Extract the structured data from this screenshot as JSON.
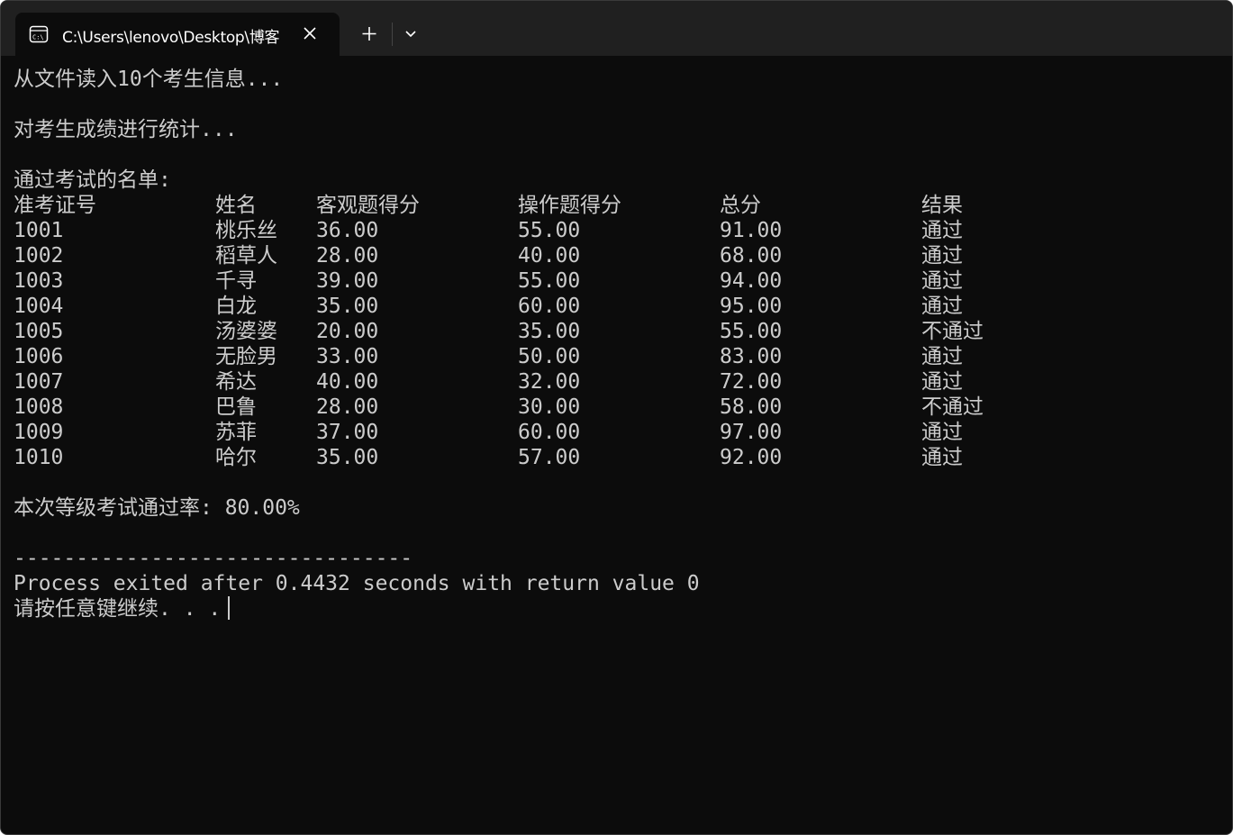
{
  "window": {
    "tab_title": "C:\\Users\\lenovo\\Desktop\\博客",
    "icons": {
      "tab": "terminal-icon",
      "close": "close-icon",
      "new_tab": "plus-icon",
      "dropdown": "chevron-down-icon"
    }
  },
  "console": {
    "line_read": "从文件读入10个考生信息...",
    "line_stats": "对考生成绩进行统计...",
    "line_pass_list": "通过考试的名单:",
    "table": {
      "headers": [
        "准考证号",
        "姓名",
        "客观题得分",
        "操作题得分",
        "总分",
        "结果"
      ],
      "rows": [
        [
          "1001",
          "桃乐丝",
          "36.00",
          "55.00",
          "91.00",
          "通过"
        ],
        [
          "1002",
          "稻草人",
          "28.00",
          "40.00",
          "68.00",
          "通过"
        ],
        [
          "1003",
          "千寻",
          "39.00",
          "55.00",
          "94.00",
          "通过"
        ],
        [
          "1004",
          "白龙",
          "35.00",
          "60.00",
          "95.00",
          "通过"
        ],
        [
          "1005",
          "汤婆婆",
          "20.00",
          "35.00",
          "55.00",
          "不通过"
        ],
        [
          "1006",
          "无脸男",
          "33.00",
          "50.00",
          "83.00",
          "通过"
        ],
        [
          "1007",
          "希达",
          "40.00",
          "32.00",
          "72.00",
          "通过"
        ],
        [
          "1008",
          "巴鲁",
          "28.00",
          "30.00",
          "58.00",
          "不通过"
        ],
        [
          "1009",
          "苏菲",
          "37.00",
          "60.00",
          "97.00",
          "通过"
        ],
        [
          "1010",
          "哈尔",
          "35.00",
          "57.00",
          "92.00",
          "通过"
        ]
      ]
    },
    "line_pass_rate": "本次等级考试通过率: 80.00%",
    "separator": "--------------------------------",
    "line_process": "Process exited after 0.4432 seconds with return value 0",
    "line_prompt": "请按任意键继续. . ."
  },
  "colors": {
    "background": "#0c0c0c",
    "tabbar": "#202020",
    "text": "#cccccc"
  }
}
